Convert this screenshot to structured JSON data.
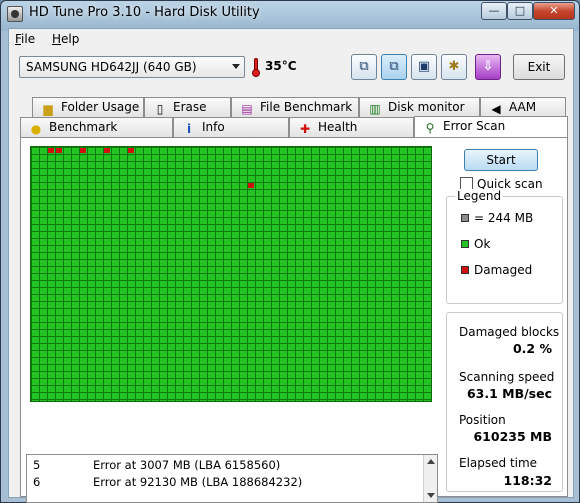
{
  "window": {
    "title": "HD Tune Pro 3.10 - Hard Disk Utility",
    "min": "—",
    "max": "□",
    "close": "✕"
  },
  "menu": {
    "file_u": "F",
    "file_rest": "ile",
    "help_u": "H",
    "help_rest": "elp"
  },
  "toolbar": {
    "drive": "SAMSUNG HD642JJ (640 GB)",
    "temperature": "35°C",
    "exit_label": "Exit",
    "icons": [
      "copy-info-icon",
      "copy-screen-icon",
      "save-icon",
      "options-icon",
      "download-icon"
    ]
  },
  "tabs": {
    "row1": [
      "Folder Usage",
      "Erase",
      "File Benchmark",
      "Disk monitor",
      "AAM"
    ],
    "row2": [
      "Benchmark",
      "Info",
      "Health",
      "Error Scan"
    ],
    "active": "Error Scan"
  },
  "scan": {
    "start_label": "Start",
    "quick_scan_label": "Quick scan",
    "quick_scan_checked": false,
    "legend_title": "Legend",
    "legend": [
      {
        "label": "= 244 MB",
        "color": "#8a8a8a"
      },
      {
        "label": "Ok",
        "color": "#22c322"
      },
      {
        "label": "Damaged",
        "color": "#d01010"
      }
    ],
    "stats": [
      {
        "label": "Damaged blocks",
        "value": "0.2 %"
      },
      {
        "label": "Scanning speed",
        "value": "63.1 MB/sec"
      },
      {
        "label": "Position",
        "value": "610235 MB"
      },
      {
        "label": "Elapsed time",
        "value": "118:32"
      }
    ],
    "log": [
      {
        "n": "5",
        "msg": "Error at 3007 MB (LBA 6158560)"
      },
      {
        "n": "6",
        "msg": "Error at 92130 MB (LBA 188684232)"
      }
    ],
    "grid_colors": {
      "ok": "#22c322",
      "damaged": "#d01010",
      "lines": "#0e7a0e"
    }
  }
}
